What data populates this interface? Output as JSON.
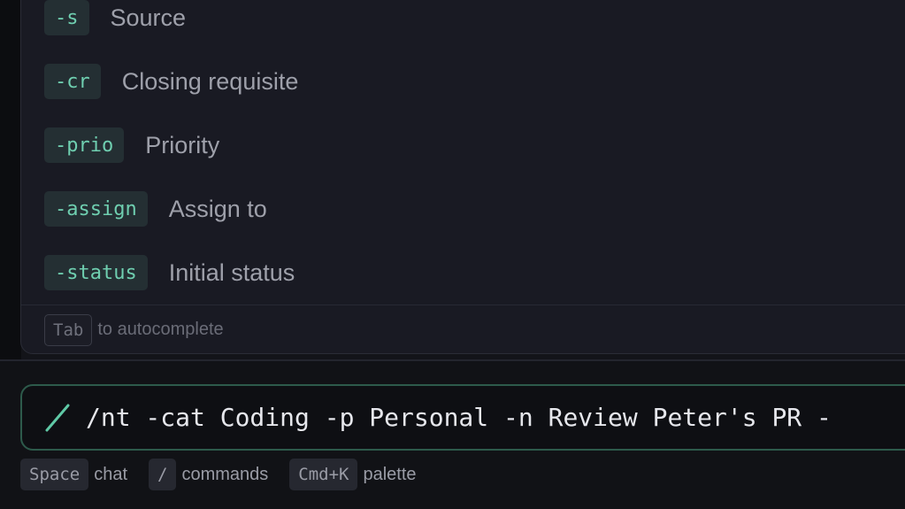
{
  "flags": [
    {
      "flag": "-s",
      "description": "Source"
    },
    {
      "flag": "-cr",
      "description": "Closing requisite"
    },
    {
      "flag": "-prio",
      "description": "Priority"
    },
    {
      "flag": "-assign",
      "description": "Assign to"
    },
    {
      "flag": "-status",
      "description": "Initial status"
    }
  ],
  "autocomplete_hint": {
    "key": "Tab",
    "text": "to autocomplete"
  },
  "command_input": {
    "value": "/nt -cat Coding -p Personal -n Review Peter's PR -",
    "icon": "slash-icon"
  },
  "shortcuts": [
    {
      "key": "Space",
      "label": "chat"
    },
    {
      "key": "/",
      "label": "commands"
    },
    {
      "key": "Cmd+K",
      "label": "palette"
    }
  ],
  "colors": {
    "background": "#131419",
    "flag_text": "#6fcfb0",
    "input_border": "#2d5a4b",
    "accent": "#5fc9a6"
  }
}
